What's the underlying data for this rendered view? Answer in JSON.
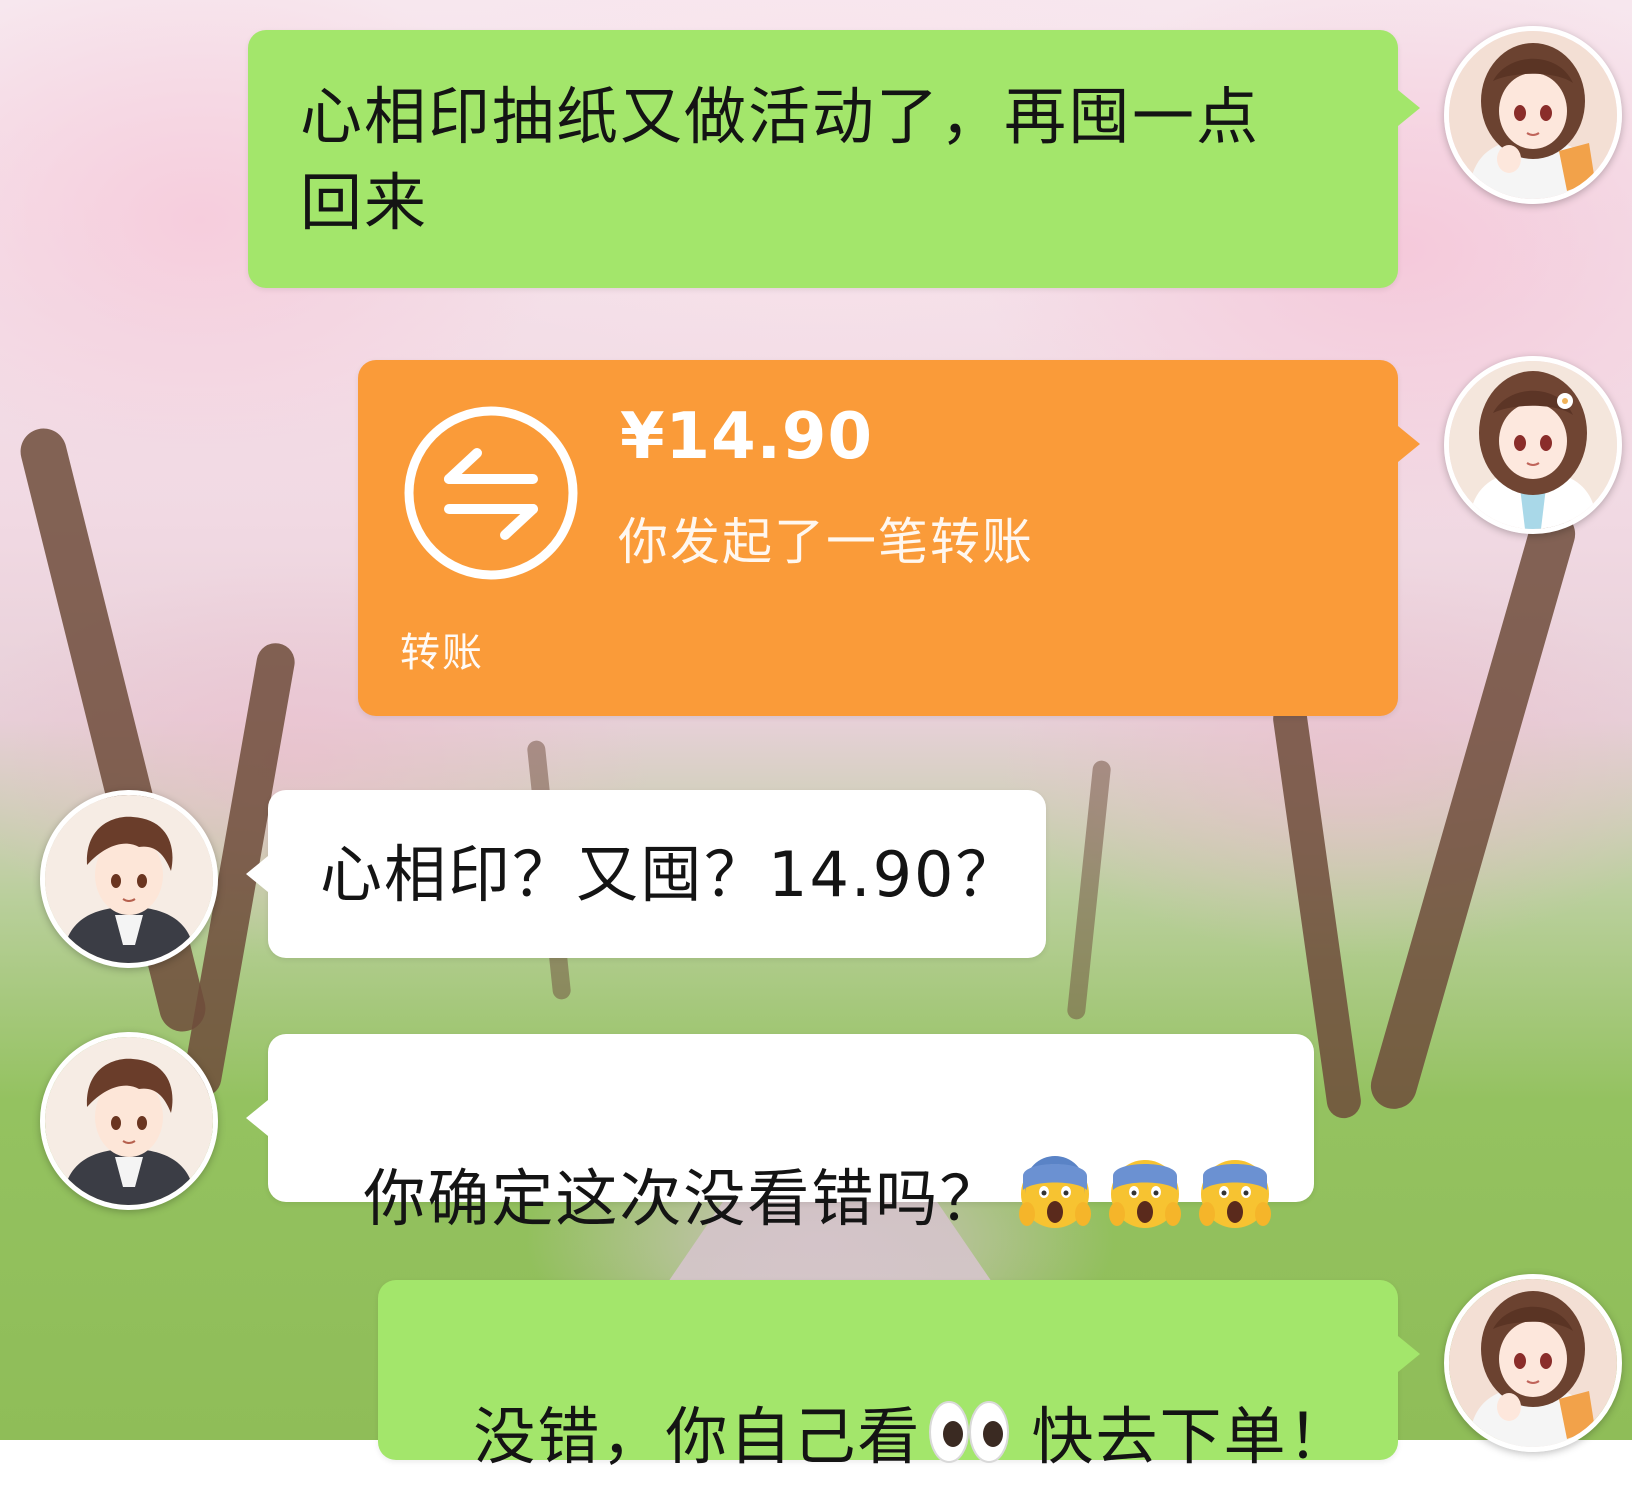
{
  "messages": [
    {
      "side": "right",
      "type": "text",
      "text": "心相印抽纸又做活动了，再囤一点回来",
      "line1": "心相印抽纸又做活动了，再囤一点",
      "line2": "回来",
      "sender": "girl"
    },
    {
      "side": "right",
      "type": "transfer",
      "amount": "¥14.90",
      "description": "你发起了一笔转账",
      "footer": "转账",
      "icon": "transfer-arrows-icon",
      "sender": "girl"
    },
    {
      "side": "left",
      "type": "text",
      "text": "心相印？又囤？14.90？",
      "sender": "boy"
    },
    {
      "side": "left",
      "type": "text",
      "text": "你确定这次没看错吗？",
      "emojis": [
        "face-screaming-in-fear",
        "face-screaming-in-fear",
        "face-screaming-in-fear"
      ],
      "sender": "boy"
    },
    {
      "side": "right",
      "type": "text",
      "text_before": "没错，你自己看",
      "emoji": "eyes",
      "text_after": "快去下单！",
      "sender": "girl"
    }
  ],
  "colors": {
    "sent_bubble": "#a3e66b",
    "received_bubble": "#ffffff",
    "transfer_bubble": "#fa9b39",
    "text": "#141414"
  }
}
